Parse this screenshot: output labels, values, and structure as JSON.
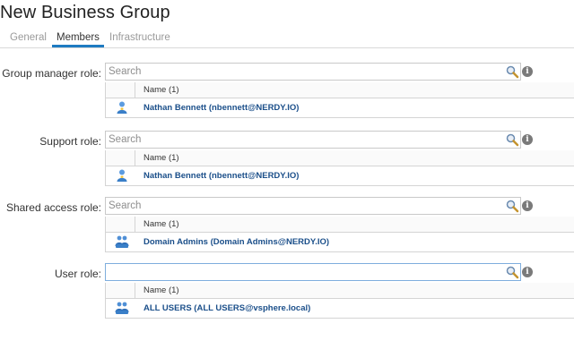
{
  "page": {
    "title": "New Business Group"
  },
  "tabs": [
    {
      "label": "General",
      "active": false
    },
    {
      "label": "Members",
      "active": true
    },
    {
      "label": "Infrastructure",
      "active": false
    }
  ],
  "roles": [
    {
      "label": "Group manager role:",
      "search_placeholder": "Search",
      "search_value": "",
      "column_header": "Name (1)",
      "member": {
        "name": "Nathan Bennett (nbennett@NERDY.IO)",
        "type": "user-icon"
      }
    },
    {
      "label": "Support role:",
      "search_placeholder": "Search",
      "search_value": "",
      "column_header": "Name (1)",
      "member": {
        "name": "Nathan Bennett (nbennett@NERDY.IO)",
        "type": "user-icon"
      }
    },
    {
      "label": "Shared access role:",
      "search_placeholder": "Search",
      "search_value": "",
      "column_header": "Name (1)",
      "member": {
        "name": "Domain Admins (Domain Admins@NERDY.IO)",
        "type": "group-icon"
      }
    },
    {
      "label": "User role:",
      "search_placeholder": "",
      "search_value": "",
      "column_header": "Name (1)",
      "member": {
        "name": "ALL USERS (ALL USERS@vsphere.local)",
        "type": "group-icon"
      }
    }
  ],
  "colors": {
    "accent": "#1e7bc2",
    "link": "#1b4f8a",
    "user_icon": "#3a7fc8",
    "group_icon": "#2f6fb8"
  }
}
